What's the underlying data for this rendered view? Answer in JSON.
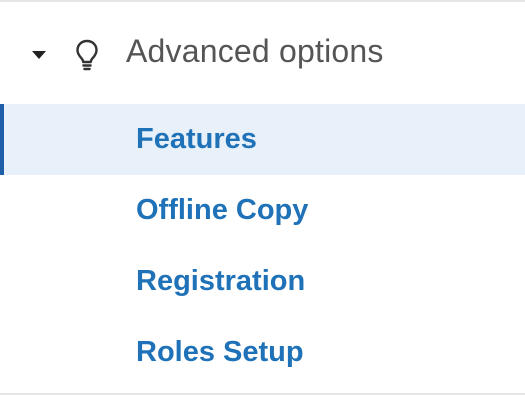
{
  "section": {
    "title": "Advanced options",
    "expanded": true,
    "caret_icon": "caret-down-icon",
    "icon": "lightbulb-icon"
  },
  "nav": {
    "items": [
      {
        "label": "Features",
        "active": true
      },
      {
        "label": "Offline Copy",
        "active": false
      },
      {
        "label": "Registration",
        "active": false
      },
      {
        "label": "Roles Setup",
        "active": false
      }
    ]
  },
  "colors": {
    "link": "#1f72b7",
    "active_background": "#e8f0fa",
    "active_indicator": "#1f5fa8",
    "header_text": "#555555"
  }
}
